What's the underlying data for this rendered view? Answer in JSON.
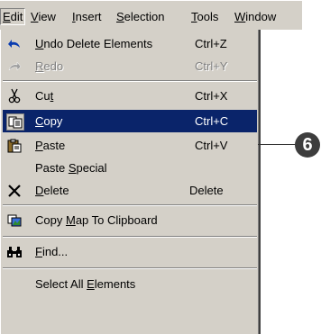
{
  "menubar": {
    "items": [
      {
        "pre": "",
        "u": "E",
        "post": "dit"
      },
      {
        "pre": "",
        "u": "V",
        "post": "iew"
      },
      {
        "pre": "",
        "u": "I",
        "post": "nsert"
      },
      {
        "pre": "",
        "u": "S",
        "post": "election"
      },
      {
        "pre": "",
        "u": "T",
        "post": "ools"
      },
      {
        "pre": "",
        "u": "W",
        "post": "indow"
      }
    ]
  },
  "menu": {
    "undo": {
      "pre": "",
      "u": "U",
      "post": "ndo Delete Elements",
      "shortcut": "Ctrl+Z",
      "icon": "undo-arrow"
    },
    "redo": {
      "pre": "",
      "u": "R",
      "post": "edo",
      "shortcut": "Ctrl+Y",
      "icon": "redo-arrow"
    },
    "cut": {
      "pre": "Cu",
      "u": "t",
      "post": "",
      "shortcut": "Ctrl+X",
      "icon": "scissors"
    },
    "copy": {
      "pre": "",
      "u": "C",
      "post": "opy",
      "shortcut": "Ctrl+C",
      "icon": "copy-pages"
    },
    "paste": {
      "pre": "",
      "u": "P",
      "post": "aste",
      "shortcut": "Ctrl+V",
      "icon": "clipboard"
    },
    "paste_special": {
      "pre": "Paste ",
      "u": "S",
      "post": "pecial"
    },
    "delete": {
      "pre": "",
      "u": "D",
      "post": "elete",
      "shortcut": "Delete",
      "icon": "x-mark"
    },
    "copy_map": {
      "pre": "Copy ",
      "u": "M",
      "post": "ap To Clipboard",
      "icon": "copy-map"
    },
    "find": {
      "pre": "",
      "u": "F",
      "post": "ind...",
      "icon": "binoculars"
    },
    "select_all": {
      "pre": "Select All ",
      "u": "E",
      "post": "lements"
    }
  },
  "callout": {
    "number": "6"
  },
  "colors": {
    "menu_bg": "#d4d0c8",
    "highlight": "#0a246a",
    "callout": "#3d3d3d"
  }
}
